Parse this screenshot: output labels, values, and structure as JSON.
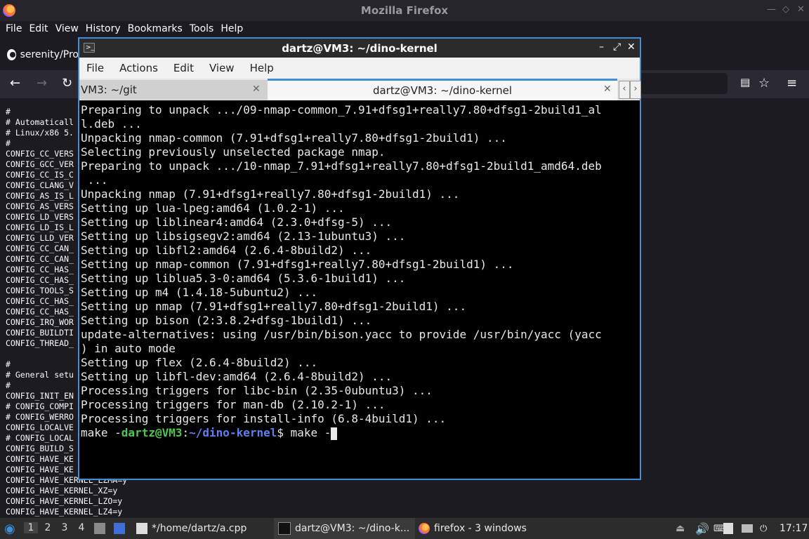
{
  "firefox": {
    "window_title": "Mozilla Firefox",
    "menu": [
      "File",
      "Edit",
      "View",
      "History",
      "Bookmarks",
      "Tools",
      "Help"
    ],
    "tab_title": "serenity/Pro",
    "page_lines": [
      "#",
      "# Automaticall",
      "# Linux/x86 5.",
      "#",
      "CONFIG_CC_VERS",
      "CONFIG_GCC_VER",
      "CONFIG_CC_IS_C",
      "CONFIG_CLANG_V",
      "CONFIG_AS_IS_L",
      "CONFIG_AS_VERS",
      "CONFIG_LD_VERS",
      "CONFIG_LD_IS_L",
      "CONFIG_LLD_VER",
      "CONFIG_CC_CAN_",
      "CONFIG_CC_CAN_",
      "CONFIG_CC_HAS_",
      "CONFIG_CC_HAS_",
      "CONFIG_TOOLS_S",
      "CONFIG_CC_HAS_",
      "CONFIG_CC_HAS_",
      "CONFIG_IRQ_WOR",
      "CONFIG_BUILDTI",
      "CONFIG_THREAD_",
      "",
      "#",
      "# General setu",
      "#",
      "CONFIG_INIT_EN",
      "# CONFIG_COMPI",
      "# CONFIG_WERRO",
      "CONFIG_LOCALVE",
      "# CONFIG_LOCAL",
      "CONFIG_BUILD_S",
      "CONFIG_HAVE_KE",
      "CONFIG_HAVE_KE",
      "CONFIG_HAVE_KERNEL_LZMA=y",
      "CONFIG_HAVE_KERNEL_XZ=y",
      "CONFIG_HAVE_KERNEL_LZO=y",
      "CONFIG_HAVE_KERNEL_LZ4=y"
    ]
  },
  "terminal": {
    "window_title": "dartz@VM3: ~/dino-kernel",
    "menu": [
      "File",
      "Actions",
      "Edit",
      "View",
      "Help"
    ],
    "tabs": [
      {
        "label": "VM3: ~/git"
      },
      {
        "label": "dartz@VM3: ~/dino-kernel"
      }
    ],
    "lines": [
      "Preparing to unpack .../09-nmap-common_7.91+dfsg1+really7.80+dfsg1-2build1_al",
      "l.deb ...",
      "Unpacking nmap-common (7.91+dfsg1+really7.80+dfsg1-2build1) ...",
      "Selecting previously unselected package nmap.",
      "Preparing to unpack .../10-nmap_7.91+dfsg1+really7.80+dfsg1-2build1_amd64.deb",
      " ...",
      "Unpacking nmap (7.91+dfsg1+really7.80+dfsg1-2build1) ...",
      "Setting up lua-lpeg:amd64 (1.0.2-1) ...",
      "Setting up liblinear4:amd64 (2.3.0+dfsg-5) ...",
      "Setting up libsigsegv2:amd64 (2.13-1ubuntu3) ...",
      "Setting up libfl2:amd64 (2.6.4-8build2) ...",
      "Setting up nmap-common (7.91+dfsg1+really7.80+dfsg1-2build1) ...",
      "Setting up liblua5.3-0:amd64 (5.3.6-1build1) ...",
      "Setting up m4 (1.4.18-5ubuntu2) ...",
      "Setting up nmap (7.91+dfsg1+really7.80+dfsg1-2build1) ...",
      "Setting up bison (2:3.8.2+dfsg-1build1) ...",
      "update-alternatives: using /usr/bin/bison.yacc to provide /usr/bin/yacc (yacc",
      ") in auto mode",
      "Setting up flex (2.6.4-8build2) ...",
      "Setting up libfl-dev:amd64 (2.6.4-8build2) ...",
      "Processing triggers for libc-bin (2.35-0ubuntu3) ...",
      "Processing triggers for man-db (2.10.2-1) ...",
      "Processing triggers for install-info (6.8-4build1) ..."
    ],
    "prompt": {
      "prefix": "make -",
      "user_host": "dartz@VM3",
      "colon": ":",
      "path": "~/dino-kernel",
      "dollar": "$ ",
      "input": "make -"
    }
  },
  "taskbar": {
    "workspaces": [
      "1",
      "2",
      "3",
      "4"
    ],
    "tasks": [
      "*/home/dartz/a.cpp",
      "dartz@VM3: ~/dino-k...",
      "firefox - 3 windows"
    ],
    "clock": "17:17"
  }
}
